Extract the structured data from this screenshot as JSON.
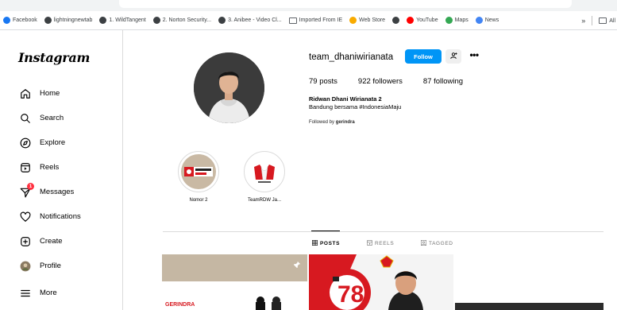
{
  "browser": {
    "bookmarks": [
      {
        "label": "Facebook",
        "icon": "facebook-icon",
        "color": "#1877f2"
      },
      {
        "label": "lightningnewtab",
        "icon": "globe-icon",
        "color": "#3c4043"
      },
      {
        "label": "1. WildTangent",
        "icon": "globe-icon",
        "color": "#3c4043"
      },
      {
        "label": "2. Norton Security...",
        "icon": "globe-icon",
        "color": "#3c4043"
      },
      {
        "label": "3. Anibee - Video Cl...",
        "icon": "globe-icon",
        "color": "#3c4043"
      },
      {
        "label": "Imported From IE",
        "icon": "folder-icon",
        "color": "#5f6368"
      },
      {
        "label": "Web Store",
        "icon": "webstore-icon",
        "color": "#f9ab00"
      },
      {
        "label": "",
        "icon": "globe-icon",
        "color": "#3c4043"
      },
      {
        "label": "YouTube",
        "icon": "youtube-icon",
        "color": "#ff0000"
      },
      {
        "label": "Maps",
        "icon": "maps-icon",
        "color": "#34a853"
      },
      {
        "label": "News",
        "icon": "news-icon",
        "color": "#4285f4"
      }
    ],
    "overflow": "»",
    "all_bookmarks": "All"
  },
  "sidebar": {
    "logo": "Instagram",
    "items": [
      {
        "label": "Home",
        "icon": "home-icon"
      },
      {
        "label": "Search",
        "icon": "search-icon"
      },
      {
        "label": "Explore",
        "icon": "compass-icon"
      },
      {
        "label": "Reels",
        "icon": "reels-icon"
      },
      {
        "label": "Messages",
        "icon": "messenger-icon",
        "badge": "1"
      },
      {
        "label": "Notifications",
        "icon": "heart-icon"
      },
      {
        "label": "Create",
        "icon": "plus-square-icon"
      },
      {
        "label": "Profile",
        "icon": "avatar-icon"
      },
      {
        "label": "More",
        "icon": "hamburger-icon"
      }
    ]
  },
  "profile": {
    "username": "team_dhaniwirianata",
    "follow_label": "Follow",
    "posts": "79 posts",
    "followers": "922 followers",
    "following": "87 following",
    "full_name": "Ridwan Dhani Wirianata 2",
    "bio": "Bandung bersama #IndonesiaMaju",
    "followed_by_prefix": "Followed by",
    "followed_by_user": "gerindra"
  },
  "highlights": [
    {
      "label": "Nomor 2"
    },
    {
      "label": "TeamRDW Ja..."
    }
  ],
  "tabs": [
    {
      "label": "POSTS",
      "active": true
    },
    {
      "label": "REELS",
      "active": false
    },
    {
      "label": "TAGGED",
      "active": false
    }
  ],
  "posts_preview": [
    {
      "caption": "GERINDRA"
    },
    {
      "caption": ""
    },
    {
      "caption": ""
    }
  ],
  "colors": {
    "accent": "#0095f6",
    "badge": "#ff3040",
    "border": "#dbdbdb",
    "gerindra_red": "#d71920"
  }
}
